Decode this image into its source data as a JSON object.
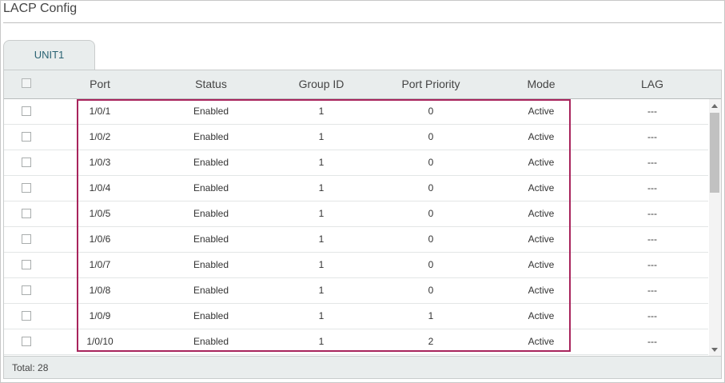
{
  "page": {
    "title": "LACP Config"
  },
  "tabs": [
    {
      "label": "UNIT1"
    }
  ],
  "table": {
    "columns": [
      "Port",
      "Status",
      "Group ID",
      "Port Priority",
      "Mode",
      "LAG"
    ],
    "rows": [
      [
        "1/0/1",
        "Enabled",
        "1",
        "0",
        "Active",
        "---"
      ],
      [
        "1/0/2",
        "Enabled",
        "1",
        "0",
        "Active",
        "---"
      ],
      [
        "1/0/3",
        "Enabled",
        "1",
        "0",
        "Active",
        "---"
      ],
      [
        "1/0/4",
        "Enabled",
        "1",
        "0",
        "Active",
        "---"
      ],
      [
        "1/0/5",
        "Enabled",
        "1",
        "0",
        "Active",
        "---"
      ],
      [
        "1/0/6",
        "Enabled",
        "1",
        "0",
        "Active",
        "---"
      ],
      [
        "1/0/7",
        "Enabled",
        "1",
        "0",
        "Active",
        "---"
      ],
      [
        "1/0/8",
        "Enabled",
        "1",
        "0",
        "Active",
        "---"
      ],
      [
        "1/0/9",
        "Enabled",
        "1",
        "1",
        "Active",
        "---"
      ],
      [
        "1/0/10",
        "Enabled",
        "1",
        "2",
        "Active",
        "---"
      ]
    ]
  },
  "footer": {
    "total": "Total: 28"
  },
  "colors": {
    "highlight": "#a8245c",
    "tab_text": "#2a6373",
    "header_bg": "#e9eded"
  }
}
